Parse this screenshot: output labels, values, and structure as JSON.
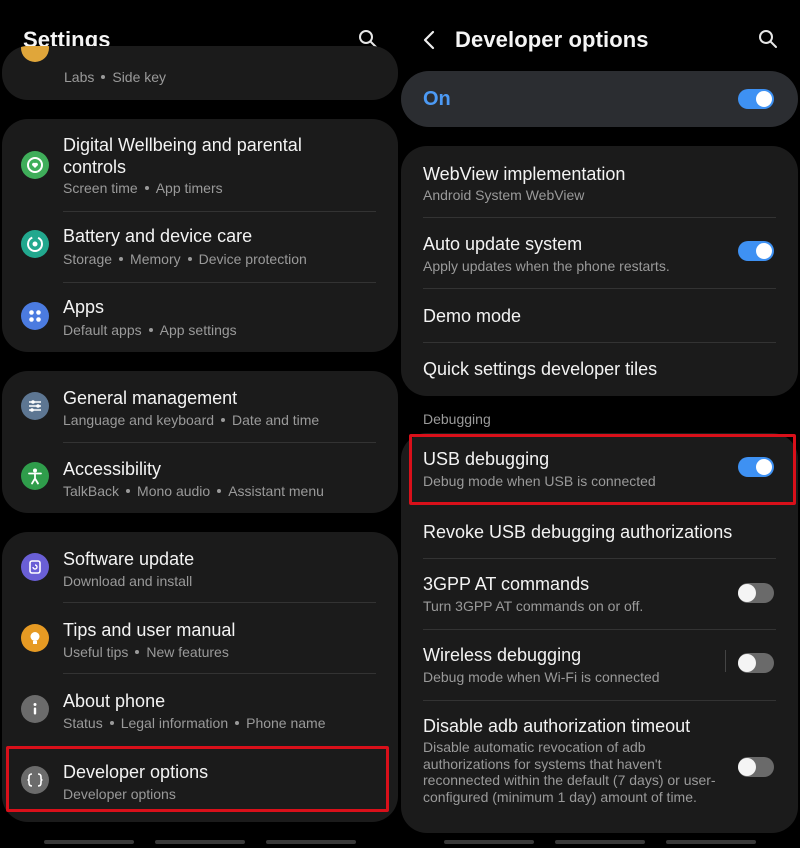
{
  "left": {
    "title": "Settings",
    "top_partial": {
      "subtitle": [
        "Labs",
        "Side key"
      ]
    },
    "group1": [
      {
        "title": "Digital Wellbeing and parental controls",
        "subtitle": [
          "Screen time",
          "App timers"
        ],
        "icon": "wellbeing-icon",
        "color": "#3fae5a"
      },
      {
        "title": "Battery and device care",
        "subtitle": [
          "Storage",
          "Memory",
          "Device protection"
        ],
        "icon": "device-care-icon",
        "color": "#22a88e"
      },
      {
        "title": "Apps",
        "subtitle": [
          "Default apps",
          "App settings"
        ],
        "icon": "apps-icon",
        "color": "#4b7be0"
      }
    ],
    "group2": [
      {
        "title": "General management",
        "subtitle": [
          "Language and keyboard",
          "Date and time"
        ],
        "icon": "general-management-icon",
        "color": "#5d7692"
      },
      {
        "title": "Accessibility",
        "subtitle": [
          "TalkBack",
          "Mono audio",
          "Assistant menu"
        ],
        "icon": "accessibility-icon",
        "color": "#2f9d4b"
      }
    ],
    "group3": [
      {
        "title": "Software update",
        "subtitle": [
          "Download and install"
        ],
        "icon": "software-update-icon",
        "color": "#6a5fd6"
      },
      {
        "title": "Tips and user manual",
        "subtitle": [
          "Useful tips",
          "New features"
        ],
        "icon": "tips-icon",
        "color": "#e69a23"
      },
      {
        "title": "About phone",
        "subtitle": [
          "Status",
          "Legal information",
          "Phone name"
        ],
        "icon": "info-icon",
        "color": "#6b6b6b"
      },
      {
        "title": "Developer options",
        "subtitle": [
          "Developer options"
        ],
        "icon": "developer-options-icon",
        "color": "#6b6b6b"
      }
    ]
  },
  "right": {
    "title": "Developer options",
    "master": {
      "label": "On",
      "state": true
    },
    "group1": [
      {
        "title": "WebView implementation",
        "subtitle": "Android System WebView"
      },
      {
        "title": "Auto update system",
        "subtitle": "Apply updates when the phone restarts.",
        "toggle": true
      },
      {
        "title": "Demo mode"
      },
      {
        "title": "Quick settings developer tiles"
      }
    ],
    "section_label": "Debugging",
    "group2": [
      {
        "title": "USB debugging",
        "subtitle": "Debug mode when USB is connected",
        "toggle": true
      },
      {
        "title": "Revoke USB debugging authorizations"
      },
      {
        "title": "3GPP AT commands",
        "subtitle": "Turn 3GPP AT commands on or off.",
        "toggle": false
      },
      {
        "title": "Wireless debugging",
        "subtitle": "Debug mode when Wi-Fi is connected",
        "toggle": false
      },
      {
        "title": "Disable adb authorization timeout",
        "subtitle": "Disable automatic revocation of adb authorizations for systems that haven't reconnected within the default (7 days) or user-configured (minimum 1 day) amount of time.",
        "toggle": false
      }
    ]
  },
  "colors": {
    "accent": "#3e91f3",
    "highlight": "#d9101a",
    "card": "#1b1b1b"
  }
}
